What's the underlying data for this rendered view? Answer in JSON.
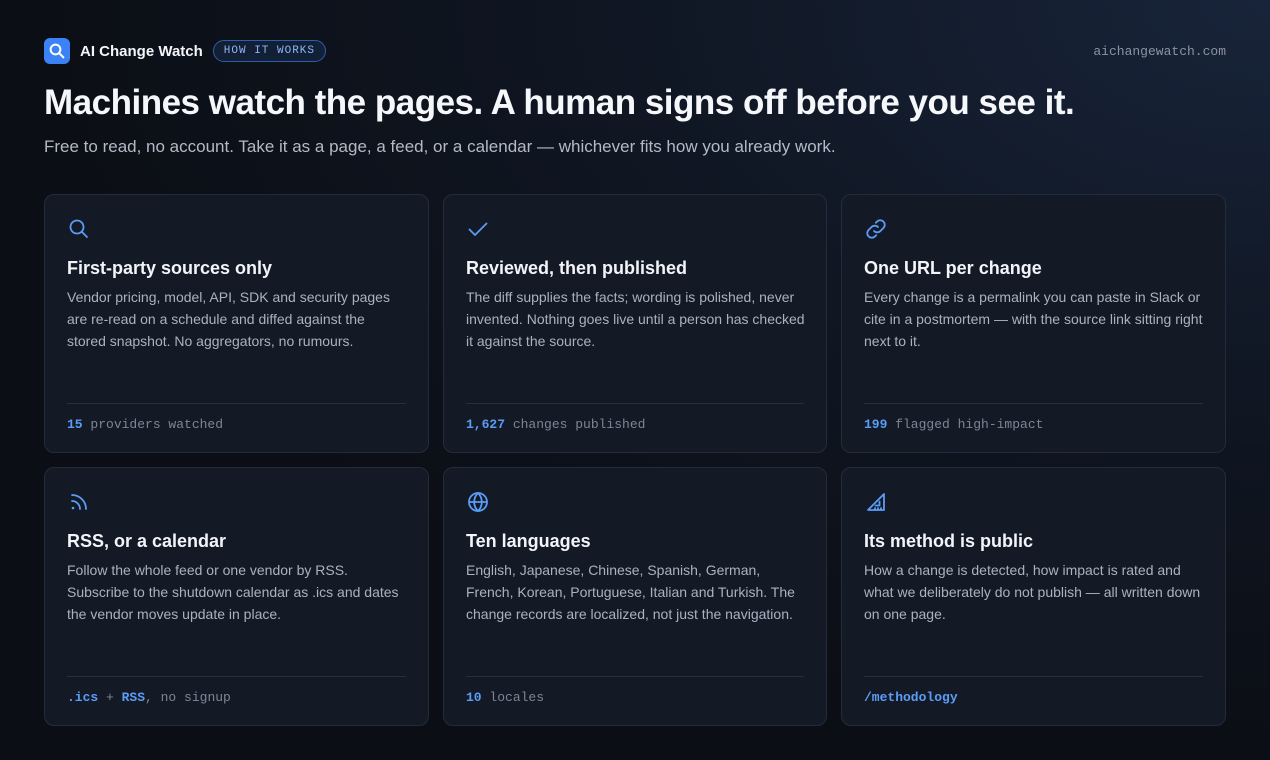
{
  "header": {
    "brand": "AI Change Watch",
    "pill": "HOW IT WORKS",
    "domain": "aichangewatch.com"
  },
  "hero": {
    "title": "Machines watch the pages. A human signs off before you see it.",
    "subtitle": "Free to read, no account. Take it as a page, a feed, or a calendar — whichever fits how you already work."
  },
  "cards": [
    {
      "icon": "search-icon",
      "title": "First-party sources only",
      "text": "Vendor pricing, model, API, SDK and security pages are re-read on a schedule and diffed against the stored snapshot. No aggregators, no rumours.",
      "foot_value": "15",
      "foot_label": " providers watched"
    },
    {
      "icon": "check-icon",
      "title": "Reviewed, then published",
      "text": "The diff supplies the facts; wording is polished, never invented. Nothing goes live until a person has checked it against the source.",
      "foot_value": "1,627",
      "foot_label": " changes published"
    },
    {
      "icon": "link-icon",
      "title": "One URL per change",
      "text": "Every change is a permalink you can paste in Slack or cite in a postmortem — with the source link sitting right next to it.",
      "foot_value": "199",
      "foot_label": " flagged high-impact"
    },
    {
      "icon": "rss-icon",
      "title": "RSS, or a calendar",
      "text": "Follow the whole feed or one vendor by RSS. Subscribe to the shutdown calendar as .ics and dates the vendor moves update in place.",
      "foot_a": ".ics",
      "foot_plus": " + ",
      "foot_b": "RSS",
      "foot_rest": ", no signup"
    },
    {
      "icon": "globe-icon",
      "title": "Ten languages",
      "text": "English, Japanese, Chinese, Spanish, German, French, Korean, Portuguese, Italian and Turkish. The change records are localized, not just the navigation.",
      "foot_value": "10",
      "foot_label": " locales"
    },
    {
      "icon": "ruler-triangle-icon",
      "title": "Its method is public",
      "text": "How a change is detected, how impact is rated and what we deliberately do not publish — all written down on one page.",
      "foot_value": "/methodology"
    }
  ],
  "colors": {
    "accent": "#5b9cf6",
    "brand_blue": "#3b82f6",
    "card_bg": "#131a26",
    "page_bg": "#0b0e14"
  }
}
